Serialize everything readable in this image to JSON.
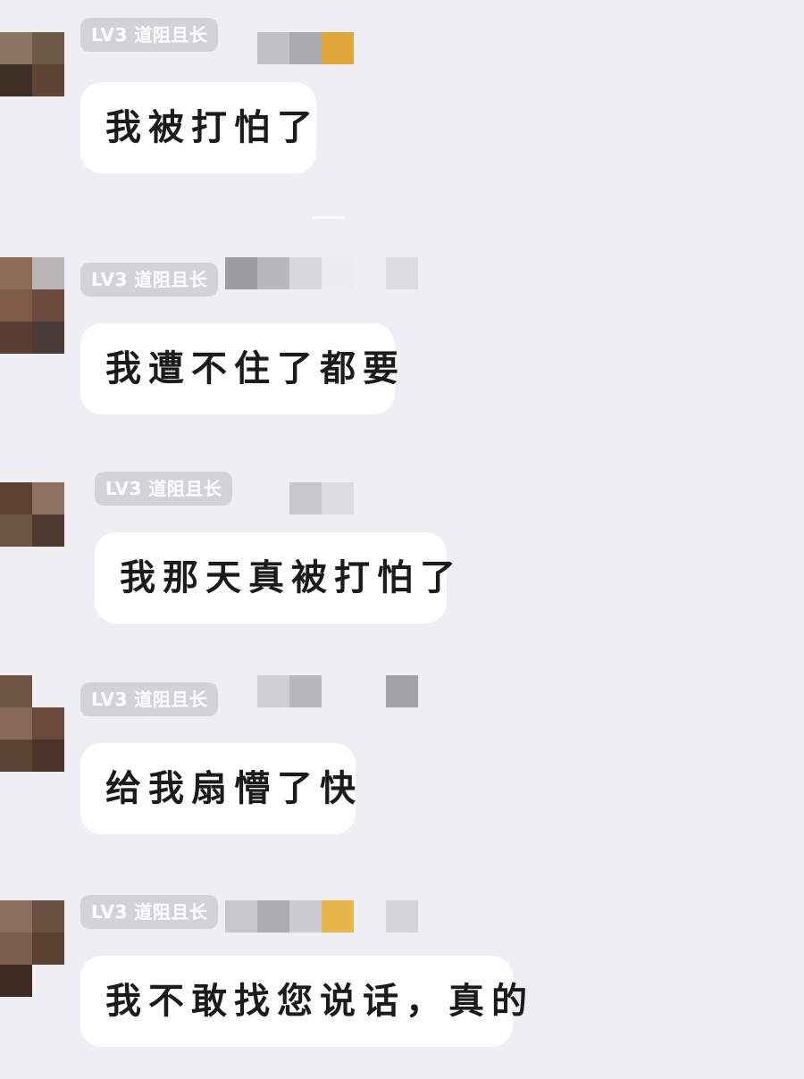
{
  "messages": [
    {
      "level": "LV3",
      "title": "道阻且长",
      "text": "我被打怕了",
      "avatar_colors": [
        "#8a7660",
        "#6e5a48",
        "#3e2d24",
        "#5d4636",
        "#f2f2f4",
        "#f2f2f4"
      ],
      "mosaic_colors": [
        "#c2c2c6",
        "#a9a9ae",
        "#e1a63a"
      ]
    },
    {
      "level": "LV3",
      "title": "道阻且长",
      "text": "我遭不住了都要",
      "avatar_colors": [
        "#8c6c58",
        "#b8b5b6",
        "#7f5c48",
        "#6a4a3c",
        "#5a3e32",
        "#4a3c38"
      ],
      "mosaic_colors": [
        "#9c9ca0",
        "#b9b9bd",
        "#d8d8dc",
        "#ececef",
        "#f0f0f3",
        "#dcdce0"
      ]
    },
    {
      "level": "LV3",
      "title": "道阻且长",
      "text": "我那天真被打怕了",
      "avatar_colors": [
        "#5e4230",
        "#8e7260",
        "#6c5444",
        "#4e3a2e",
        "#f0f0f3",
        "#f0f0f3"
      ],
      "mosaic_colors": [
        "#c8c8cc",
        "#dcdce0"
      ]
    },
    {
      "level": "LV3",
      "title": "道阻且长",
      "text": "给我扇懵了快",
      "avatar_colors": [
        "#6e5444",
        "#f0f0f3",
        "#87685a",
        "#6a4a3c",
        "#5c4232",
        "#4c3228"
      ],
      "mosaic_colors": [
        "#d0d0d4",
        "#b8b8bc",
        "#a2a2a6"
      ]
    },
    {
      "level": "LV3",
      "title": "道阻且长",
      "text": "我不敢找您说话，真的",
      "avatar_colors": [
        "#8a705c",
        "#6a5040",
        "#7c5e4c",
        "#5a4030",
        "#3e2c24",
        "#f0f0f3"
      ],
      "mosaic_colors": [
        "#c8c8cc",
        "#ababb0",
        "#cbcbd0",
        "#e8b648",
        "#d3d3d8"
      ]
    }
  ]
}
